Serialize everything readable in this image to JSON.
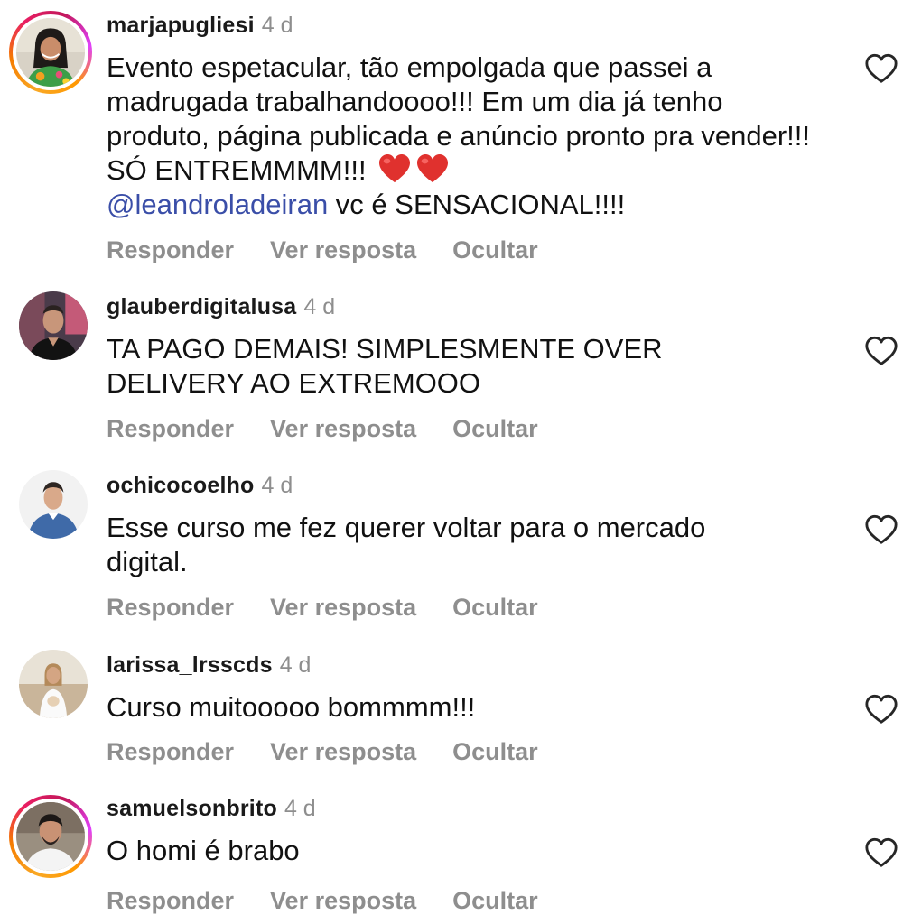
{
  "comments": [
    {
      "username": "marjapugliesi",
      "time": "4 d",
      "text_before_mention": "Evento espetacular, tão empolgada que passei a madrugada trabalhandoooo!!! Em um dia já tenho produto, página publicada e anúncio pronto pra vender!!! SÓ ENTREMMMM!!!",
      "mention": "@leandroladeiran",
      "text_after_mention": " vc é SENSACIONAL!!!!",
      "emoji": [
        "red-heart",
        "red-heart"
      ],
      "story_ring": true
    },
    {
      "username": "glauberdigitalusa",
      "time": "4 d",
      "text": "TA PAGO DEMAIS! SIMPLESMENTE OVER DELIVERY AO EXTREMOOO",
      "story_ring": false
    },
    {
      "username": "ochicocoelho",
      "time": "4 d",
      "text": "Esse curso me fez querer voltar para o mercado digital.",
      "story_ring": false
    },
    {
      "username": "larissa_lrsscds",
      "time": "4 d",
      "text": "Curso muitooooo bommmm!!!",
      "story_ring": false
    },
    {
      "username": "samuelsonbrito",
      "time": "4 d",
      "text": "O homi é brabo",
      "story_ring": true
    }
  ],
  "actions": {
    "reply": "Responder",
    "view_replies": "Ver resposta",
    "hide": "Ocultar"
  },
  "icons": {
    "like": "heart-outline-icon",
    "emoji": "red-heart"
  },
  "colors": {
    "text": "#111111",
    "secondary": "#8e8e8e",
    "mention": "#3a4ea8",
    "heart_emoji": "#e0312e"
  }
}
